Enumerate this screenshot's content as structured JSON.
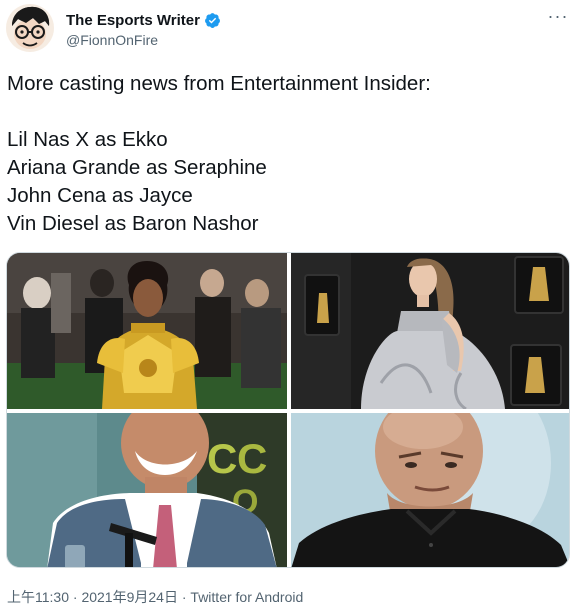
{
  "author": {
    "name": "The Esports Writer",
    "handle": "@FionnOnFire",
    "verified": true
  },
  "tweet": {
    "intro": "More casting news from Entertainment Insider:",
    "lines": [
      "Lil Nas X as Ekko",
      "Ariana Grande as Seraphine",
      "John Cena as Jayce",
      "Vin Diesel as Baron Nashor"
    ]
  },
  "media_count": 4,
  "footer": {
    "time": "上午11:30",
    "date": "2021年9月24日",
    "source": "Twitter for Android",
    "separator": "·"
  },
  "colors": {
    "text": "#0f1419",
    "secondary": "#536471",
    "verified": "#1d9bf0",
    "border": "#cfd9de"
  },
  "icons": [
    "avatar",
    "verified-badge-icon",
    "more-options-icon"
  ]
}
